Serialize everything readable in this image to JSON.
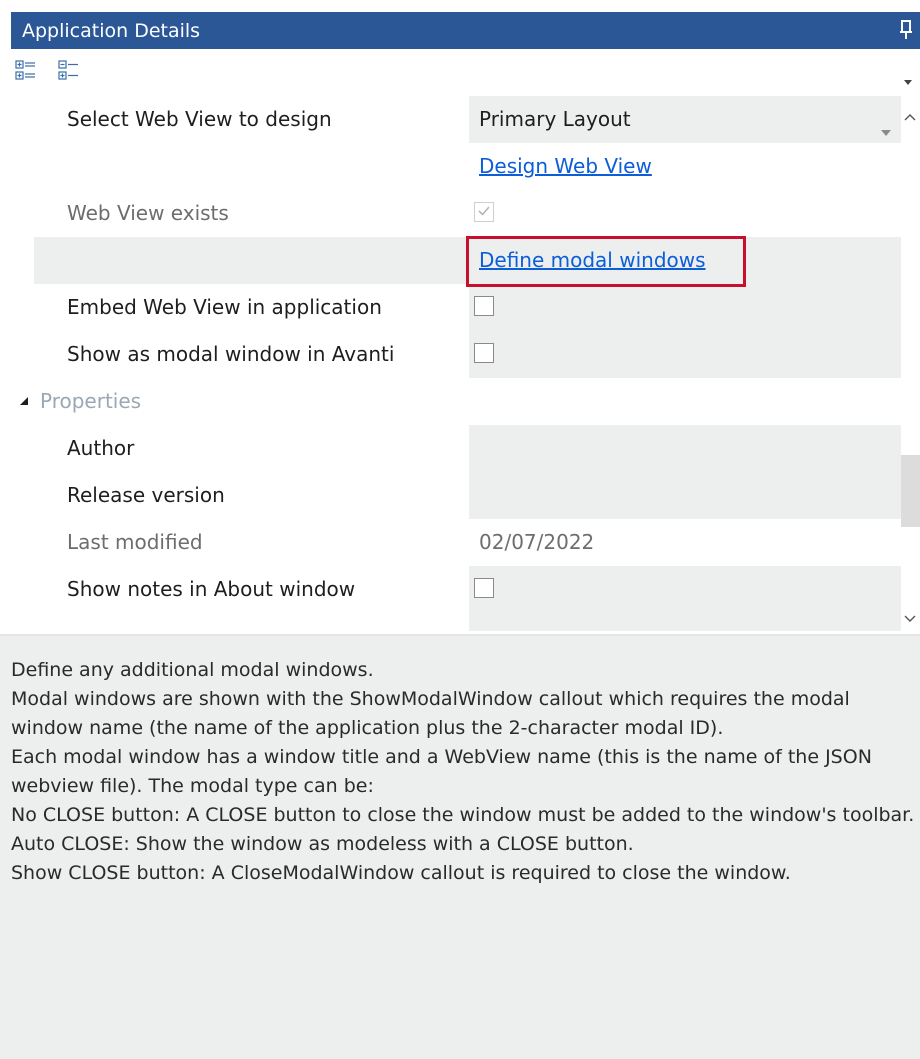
{
  "panel": {
    "title": "Application Details"
  },
  "rows": {
    "web_view_select": {
      "label": "Select Web View to design",
      "value": "Primary Layout"
    },
    "design_link": {
      "text": "Design Web View"
    },
    "web_view_exists": {
      "label": "Web View exists",
      "checked": true
    },
    "modal_link": {
      "text": "Define modal windows"
    },
    "embed": {
      "label": "Embed Web View in application",
      "checked": false
    },
    "show_modal": {
      "label": "Show as modal window in Avanti",
      "checked": false
    }
  },
  "properties": {
    "category_label": "Properties",
    "author": {
      "label": "Author",
      "value": ""
    },
    "release_version": {
      "label": "Release version",
      "value": ""
    },
    "last_modified": {
      "label": "Last modified",
      "value": "02/07/2022"
    },
    "show_notes": {
      "label": "Show notes in About window",
      "checked": false
    }
  },
  "description": {
    "lines": [
      "Define any additional modal windows.",
      "Modal windows are shown with the ShowModalWindow callout which requires the modal window name (the name of the application plus the 2-character modal ID).",
      "Each modal window has a window title and a WebView name (this is the name of the JSON webview file). The modal type can be:",
      "No CLOSE button: A CLOSE button to close the window must be added to the window's toolbar.",
      "Auto CLOSE: Show the window as modeless with a CLOSE button.",
      "Show CLOSE button: A CloseModalWindow callout is required to close the window."
    ]
  },
  "colors": {
    "title_bar": "#2b5797",
    "highlight": "#c8102e",
    "link": "#0b5ed7",
    "value_bg": "#edefef"
  },
  "icons": {
    "pin": "pin-icon",
    "categorized": "categorized-view-icon",
    "alphabetical": "alphabetical-view-icon",
    "dropdown": "chevron-down-icon",
    "collapse": "triangle-collapse-icon",
    "check": "checkmark-icon",
    "scroll_up": "chevron-up-icon",
    "scroll_down": "chevron-down-icon"
  }
}
